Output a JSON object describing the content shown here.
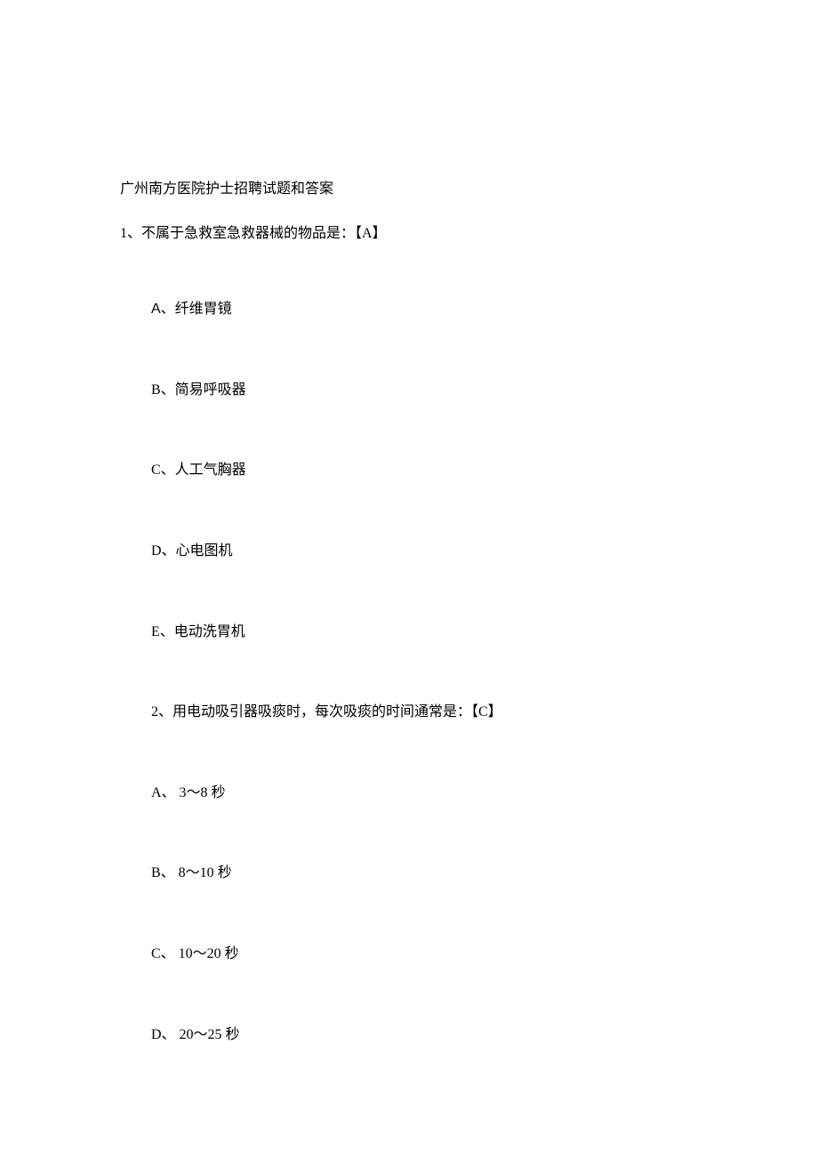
{
  "title": "广州南方医院护士招聘试题和答案",
  "q1": {
    "stem": "1、不属于急救室急救器械的物品是：【A】",
    "options": {
      "a_letter": "A",
      "a_text": "、纤维胃镜",
      "b": "B、简易呼吸器",
      "c": "C、人工气胸器",
      "d": "D、心电图机",
      "e": "E、电动洗胃机"
    }
  },
  "q2": {
    "stem": "2、用电动吸引器吸痰时，每次吸痰的时间通常是：【C】",
    "options": {
      "a": "A、 3～8 秒",
      "b": "B、 8～10 秒",
      "c": "C、 10～20 秒",
      "d": "D、 20～25 秒"
    }
  }
}
